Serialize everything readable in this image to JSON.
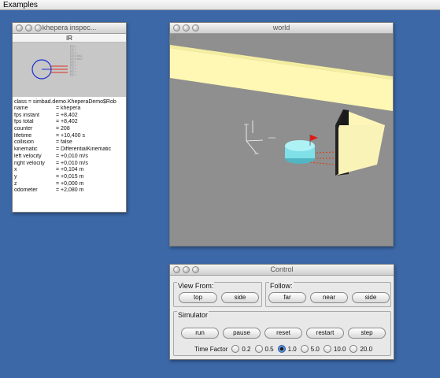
{
  "menubar": {
    "title": "Examples"
  },
  "inspector": {
    "title": "khepera inspec...",
    "sensor_label": "IR",
    "class_line": "class = simbad.demo.KheperaDemo$Rob",
    "properties": [
      {
        "key": "name",
        "value": "= khepera"
      },
      {
        "key": "fps instant",
        "value": "= +8,402"
      },
      {
        "key": "fps total",
        "value": "= +8,402"
      },
      {
        "key": "counter",
        "value": "= 208"
      },
      {
        "key": "lifetime",
        "value": "= +10,400 s"
      },
      {
        "key": "collision",
        "value": "= false"
      },
      {
        "key": "kinematic",
        "value": "= DifferentialKinematic"
      },
      {
        "key": "left velocity",
        "value": "= +0,010 m/s"
      },
      {
        "key": "right velocity",
        "value": "= +0,010 m/s"
      },
      {
        "key": "x",
        "value": "= +0,104 m"
      },
      {
        "key": "y",
        "value": "= +0,015 m"
      },
      {
        "key": "z",
        "value": "= +0,000 m"
      },
      {
        "key": "odometer",
        "value": "= +2,080 m"
      }
    ]
  },
  "world": {
    "title": "world"
  },
  "control": {
    "title": "Control",
    "view_from": {
      "title": "View From:",
      "buttons": [
        "top",
        "side"
      ]
    },
    "follow": {
      "title": "Follow:",
      "buttons": [
        "far",
        "near",
        "side"
      ]
    },
    "simulator": {
      "title": "Simulator",
      "buttons": [
        "run",
        "pause",
        "reset",
        "restart",
        "step"
      ],
      "time_factor_label": "Time Factor",
      "time_factor_options": [
        "0.2",
        "0.5",
        "1.0",
        "5.0",
        "10.0",
        "20.0"
      ],
      "time_factor_selected": "1.0"
    }
  },
  "colors": {
    "desktop": "#3c68a8",
    "floor": "#8f8f8f",
    "wall": "#fff8b0",
    "robot": "#7fe0e8",
    "sensor_ray": "#d84010"
  }
}
